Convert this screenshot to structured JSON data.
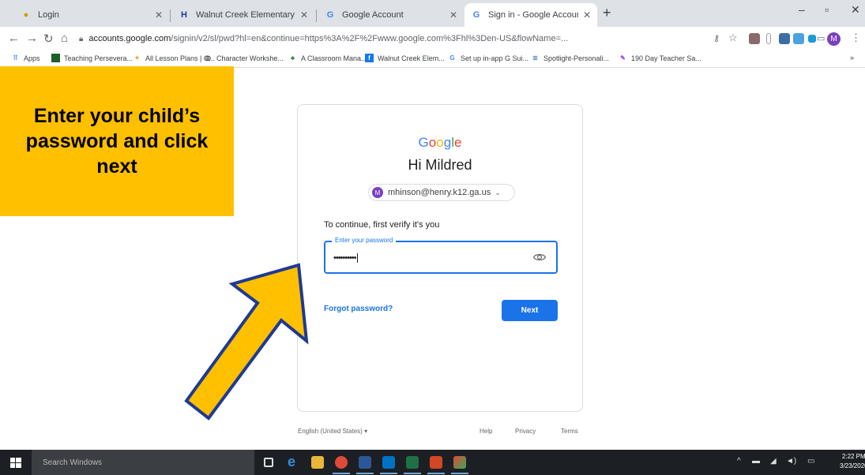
{
  "browser": {
    "tabs": [
      {
        "title": "Login",
        "favicon": "user-icon",
        "active": false
      },
      {
        "title": "Walnut Creek Elementary / Over",
        "favicon": "h-logo-icon",
        "active": false
      },
      {
        "title": "Google Account",
        "favicon": "google-icon",
        "active": false
      },
      {
        "title": "Sign in - Google Accounts",
        "favicon": "google-icon",
        "active": true
      }
    ],
    "address": {
      "host": "accounts.google.com",
      "path": "/signin/v2/sl/pwd?hl=en&continue=https%3A%2F%2Fwww.google.com%3Fhl%3Den-US&flowName=..."
    },
    "bookmarks": [
      "Apps",
      "Teaching Persevera...",
      "All Lesson Plans | C...",
      "Character Workshe...",
      "A Classroom Mana...",
      "Walnut Creek Elem...",
      "Set up in-app G Sui...",
      "Spotlight-Personali...",
      "190 Day Teacher Sa..."
    ],
    "bookmarks_more": "»",
    "profile_initial": "M"
  },
  "signin": {
    "logo": [
      "G",
      "o",
      "o",
      "g",
      "l",
      "e"
    ],
    "logo_colors": [
      "#4285f4",
      "#ea4335",
      "#fbbc05",
      "#4285f4",
      "#34a853",
      "#ea4335"
    ],
    "greeting": "Hi Mildred",
    "account_email": "mhinson@henry.k12.ga.us",
    "account_initial": "M",
    "verify_text": "To continue, first verify it's you",
    "password_label": "Enter your password",
    "password_value": "••••••••••",
    "forgot_link": "Forgot password?",
    "next_button": "Next"
  },
  "footer": {
    "language": "English (United States)",
    "help": "Help",
    "privacy": "Privacy",
    "terms": "Terms"
  },
  "callout": {
    "text": "Enter your child’s password and click next",
    "color": "#ffc000"
  },
  "taskbar": {
    "search_placeholder": "Search Windows",
    "time": "2:22 PM",
    "date": "3/23/2020"
  }
}
